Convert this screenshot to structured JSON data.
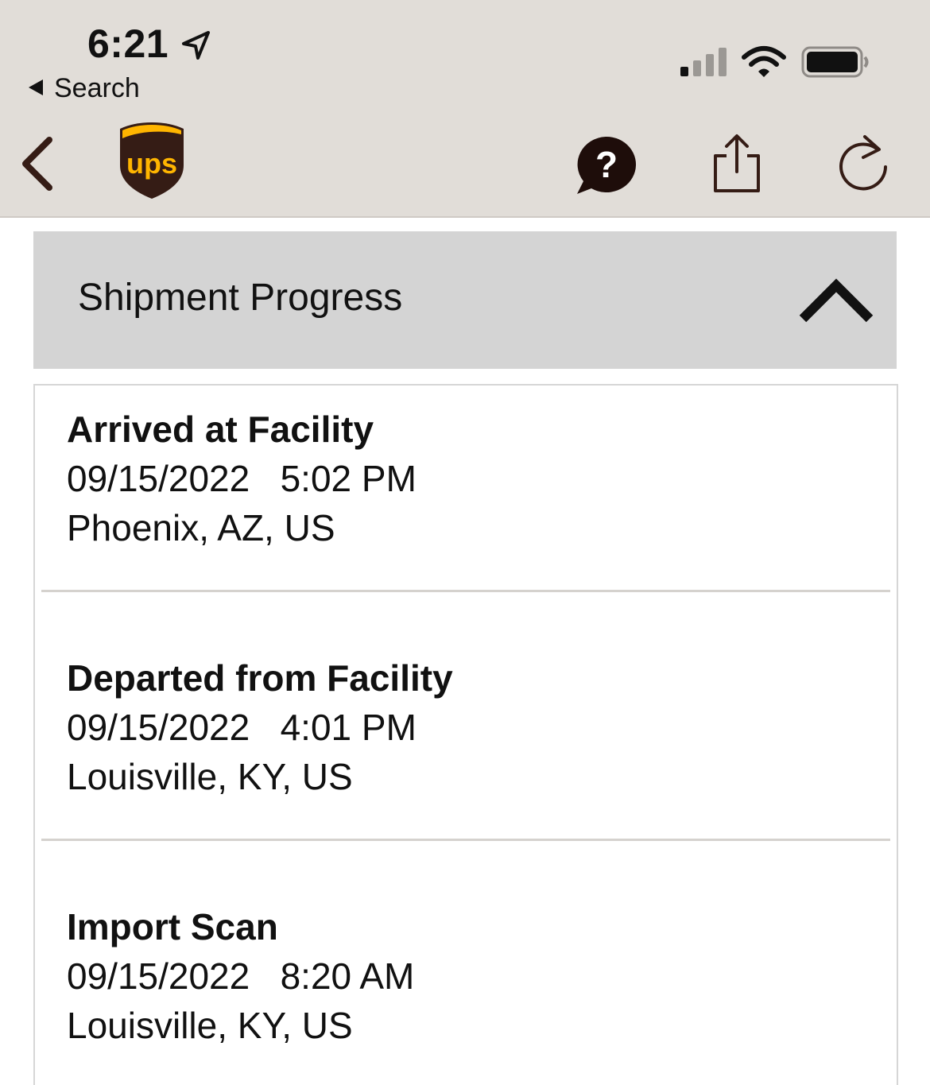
{
  "status_bar": {
    "time": "6:21",
    "back_app": "Search"
  },
  "header": {
    "logo_text": "ups",
    "icons": [
      "chevron-left-icon",
      "ups-logo",
      "help-bubble-icon",
      "share-icon",
      "refresh-icon"
    ]
  },
  "progress": {
    "title": "Shipment Progress",
    "events": [
      {
        "status": "Arrived at Facility",
        "date": "09/15/2022",
        "time": "5:02 PM",
        "location": "Phoenix, AZ, US"
      },
      {
        "status": "Departed from Facility",
        "date": "09/15/2022",
        "time": "4:01 PM",
        "location": "Louisville, KY, US"
      },
      {
        "status": "Import Scan",
        "date": "09/15/2022",
        "time": "8:20 AM",
        "location": "Louisville, KY, US"
      }
    ]
  },
  "colors": {
    "brand_brown": "#351c15",
    "brand_gold": "#ffb500",
    "topbar_bg": "#e1ddd8",
    "section_bg": "#d4d4d4"
  }
}
